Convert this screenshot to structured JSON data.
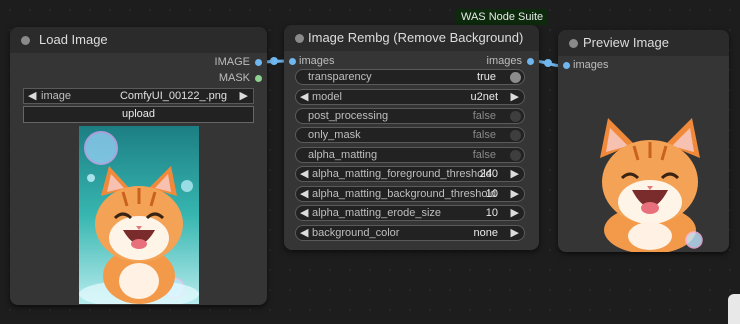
{
  "load_node": {
    "title": "Load Image",
    "outputs": [
      {
        "label": "IMAGE",
        "color": "#6fb7ee"
      },
      {
        "label": "MASK",
        "color": "#8fd18f"
      }
    ],
    "image_widget": {
      "label": "image",
      "value": "ComfyUI_00122_.png"
    },
    "upload_label": "upload"
  },
  "rembg_node": {
    "badge": "WAS Node Suite",
    "title": "Image Rembg (Remove Background)",
    "input_label": "images",
    "output_label": "images",
    "widgets": [
      {
        "type": "toggle",
        "label": "transparency",
        "value": "true"
      },
      {
        "type": "combo",
        "label": "model",
        "value": "u2net"
      },
      {
        "type": "toggle",
        "label": "post_processing",
        "value": "false"
      },
      {
        "type": "toggle",
        "label": "only_mask",
        "value": "false"
      },
      {
        "type": "toggle",
        "label": "alpha_matting",
        "value": "false"
      },
      {
        "type": "number",
        "label": "alpha_matting_foreground_threshold",
        "value": "240"
      },
      {
        "type": "number",
        "label": "alpha_matting_background_threshold",
        "value": "10"
      },
      {
        "type": "number",
        "label": "alpha_matting_erode_size",
        "value": "10"
      },
      {
        "type": "combo",
        "label": "background_color",
        "value": "none"
      }
    ]
  },
  "preview_node": {
    "title": "Preview Image",
    "input_label": "images"
  },
  "colors": {
    "link": "#6fb7ee",
    "mask": "#8fd18f",
    "node_bg": "#353535",
    "canvas": "#1d1d1d"
  }
}
